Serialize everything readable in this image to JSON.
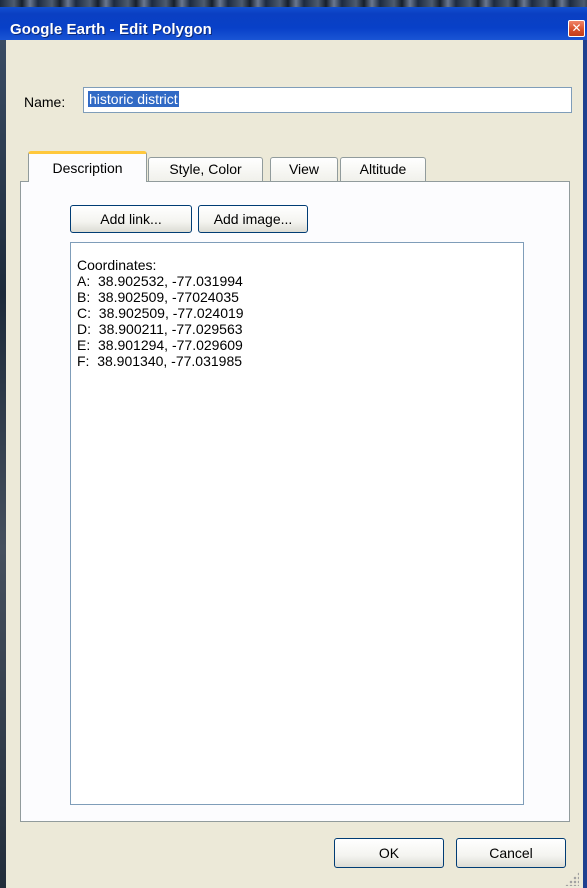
{
  "window": {
    "title": "Google Earth - Edit Polygon",
    "close_symbol": "✕"
  },
  "name_field": {
    "label": "Name:",
    "value": "historic district"
  },
  "tabs": [
    {
      "label": "Description",
      "active": true
    },
    {
      "label": "Style, Color",
      "active": false
    },
    {
      "label": "View",
      "active": false
    },
    {
      "label": "Altitude",
      "active": false
    }
  ],
  "description": {
    "add_link_label": "Add link...",
    "add_image_label": "Add image...",
    "lines": [
      "Coordinates:",
      "A:  38.902532, -77.031994",
      "B:  38.902509, -77024035",
      "C:  38.902509, -77.024019",
      "D:  38.900211, -77.029563",
      "E:  38.901294, -77.029609",
      "F:  38.901340, -77.031985"
    ]
  },
  "footer": {
    "ok_label": "OK",
    "cancel_label": "Cancel"
  },
  "colors": {
    "titlebar": "#0a3fc2",
    "dialog_bg": "#ece9d8",
    "selection": "#316ac5",
    "active_tab_accent": "#ffc83c"
  },
  "icons": {
    "close": "close-icon",
    "resize": "resize-grip-icon"
  }
}
